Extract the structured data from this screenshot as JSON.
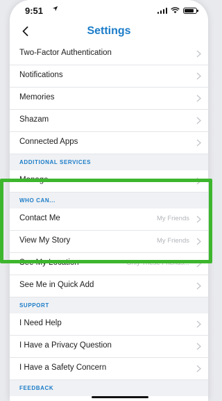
{
  "status_bar": {
    "time": "9:51",
    "location_icon": "location-arrow-icon",
    "signal_icon": "signal-bars-icon",
    "wifi_icon": "wifi-icon",
    "battery_icon": "battery-icon"
  },
  "nav": {
    "title": "Settings",
    "back_icon": "chevron-left-icon"
  },
  "sections": {
    "top_items": [
      {
        "label": "Two-Factor Authentication"
      },
      {
        "label": "Notifications"
      },
      {
        "label": "Memories"
      },
      {
        "label": "Shazam"
      },
      {
        "label": "Connected Apps"
      }
    ],
    "additional_services": {
      "header": "ADDITIONAL SERVICES",
      "items": [
        {
          "label": "Manage"
        }
      ]
    },
    "who_can": {
      "header": "WHO CAN...",
      "items": [
        {
          "label": "Contact Me",
          "value": "My Friends"
        },
        {
          "label": "View My Story",
          "value": "My Friends"
        },
        {
          "label": "See My Location",
          "value": "Only These Friends..."
        },
        {
          "label": "See Me in Quick Add",
          "value": ""
        }
      ]
    },
    "support": {
      "header": "SUPPORT",
      "items": [
        {
          "label": "I Need Help"
        },
        {
          "label": "I Have a Privacy Question"
        },
        {
          "label": "I Have a Safety Concern"
        }
      ]
    },
    "feedback": {
      "header": "FEEDBACK"
    }
  },
  "colors": {
    "accent_blue": "#1a7cc8",
    "highlight_green": "#3db62e",
    "chevron_gray": "#c4c6cb",
    "value_gray": "#b3b5ba"
  }
}
